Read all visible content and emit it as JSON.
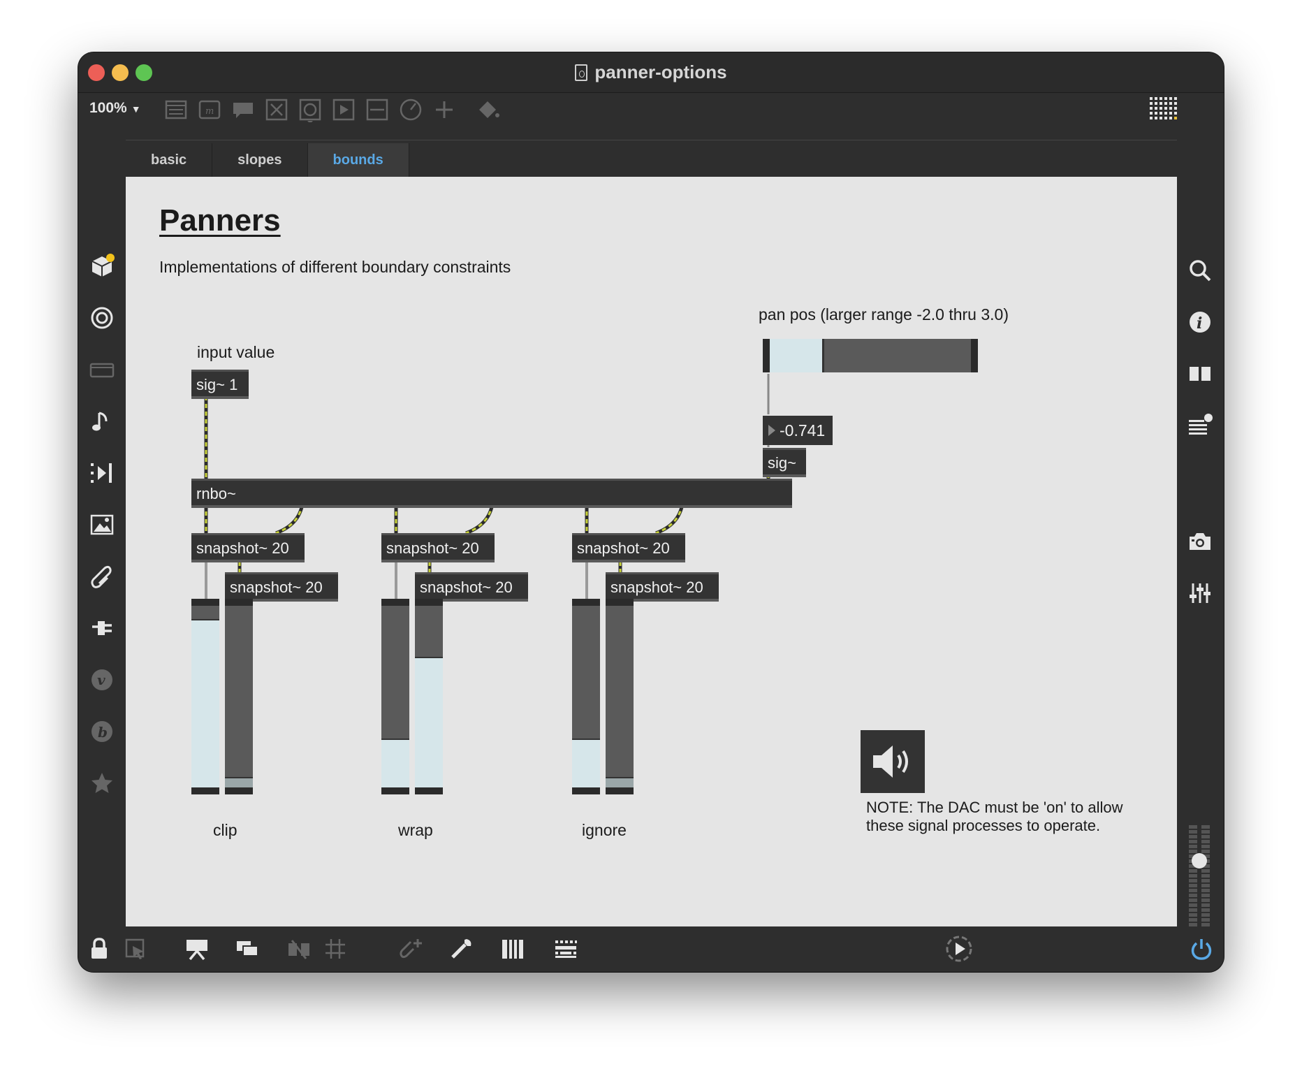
{
  "window": {
    "title": "panner-options",
    "traffic_lights": [
      "#ed5f57",
      "#f5bd4f",
      "#5ec553"
    ]
  },
  "toolbar": {
    "zoom": "100%"
  },
  "tabs": [
    {
      "label": "basic",
      "active": false
    },
    {
      "label": "slopes",
      "active": false
    },
    {
      "label": "bounds",
      "active": true
    }
  ],
  "patch": {
    "title": "Panners",
    "subtitle": "Implementations of different boundary constraints",
    "input_label": "input value",
    "pan_label": "pan pos (larger range -2.0 thru 3.0)",
    "pan_value": "-0.741",
    "pan_slider_fraction": 0.26,
    "objects": {
      "sig1": "sig~ 1",
      "sig": "sig~",
      "rnbo": "rnbo~",
      "snap": "snapshot~ 20"
    },
    "meters": [
      {
        "label": "clip",
        "left_level": 0.92,
        "right_level": 0.05
      },
      {
        "label": "wrap",
        "left_level": 0.26,
        "right_level": 0.71
      },
      {
        "label": "ignore",
        "left_level": 0.26,
        "right_level": 0.05
      }
    ],
    "note": "NOTE: The DAC must be 'on' to allow these signal processes to operate."
  },
  "colors": {
    "accent": "#5aa9e6",
    "canvas": "#e5e5e5",
    "object": "#333333",
    "meter_fill": "#d6e6ea",
    "wire": "#c8d23a"
  }
}
